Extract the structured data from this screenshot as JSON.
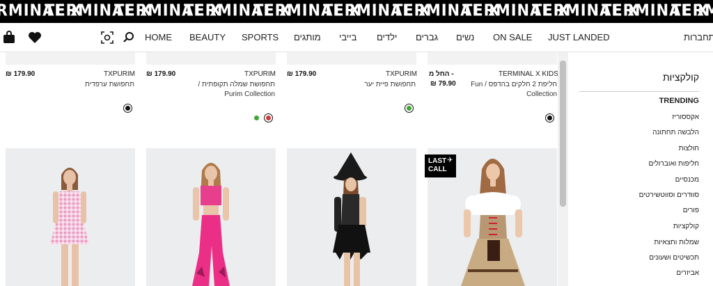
{
  "banner": {
    "words": [
      "TERMINAL X",
      "TERMINAL X",
      "TERMINAL X",
      "TERMINAL X",
      "TERMINAL X",
      "TERMINAL X",
      "TERMINAL X",
      "TERMINAL X",
      "TERMINAL X",
      "TERMINAL X",
      "TERMINAL X"
    ]
  },
  "nav": {
    "home": "HOME",
    "beauty": "BEAUTY",
    "sports": "SPORTS",
    "brands": "מותגים",
    "baby": "בייבי",
    "kids": "ילדים",
    "men": "גברים",
    "women": "נשים",
    "on_sale": "ON SALE",
    "just_landed": "JUST LANDED",
    "login": "התחברות"
  },
  "sidebar": {
    "title": "קולקציות",
    "items": [
      {
        "label": "TRENDING"
      },
      {
        "label": "אקססוריז"
      },
      {
        "label": "הלבשה תחתונה"
      },
      {
        "label": "חולצות"
      },
      {
        "label": "חליפות ואוברולים"
      },
      {
        "label": "מכנסיים"
      },
      {
        "label": "סוודרים וסווטשירטים"
      },
      {
        "label": "פורים"
      },
      {
        "label": "קולקציות"
      },
      {
        "label": "שמלות וחצאיות"
      },
      {
        "label": "תכשיטים ושעונים"
      },
      {
        "label": "אביזרים"
      }
    ]
  },
  "products": [
    {
      "brand": "TXPURIM",
      "price": "179.90",
      "currency": "₪",
      "desc": "תחפושת ערפדית",
      "swatches": [
        "#111111"
      ]
    },
    {
      "brand": "TXPURIM",
      "price": "179.90",
      "currency": "₪",
      "desc": "תחפושת שמלה תקופתית / Purim Collection",
      "swatches": [
        "#d23a3a",
        "#3fa535"
      ]
    },
    {
      "brand": "TXPURIM",
      "price": "179.90",
      "currency": "₪",
      "desc": "תחפושת פיית יער",
      "swatches": [
        "#3fa535"
      ]
    },
    {
      "brand": "TERMINAL X KIDS",
      "price": "79.90",
      "currency": "₪",
      "price_prefix": "החל מ -",
      "desc": "חליפת 2 חלקים בהדפס / Fun Collection",
      "swatches": [
        "#111111"
      ]
    }
  ],
  "badge": {
    "line1": "LAST",
    "line2": "CALL"
  }
}
